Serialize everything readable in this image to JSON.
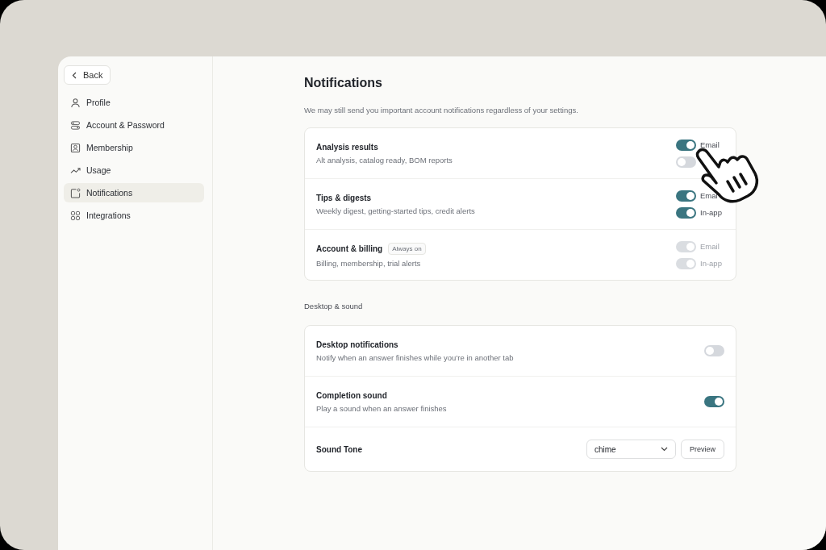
{
  "sidebar": {
    "back_button": "Back",
    "items": [
      {
        "label": "Profile",
        "selected": false
      },
      {
        "label": "Account & Password",
        "selected": false
      },
      {
        "label": "Membership",
        "selected": false
      },
      {
        "label": "Usage",
        "selected": false
      },
      {
        "label": "Notifications",
        "selected": true
      },
      {
        "label": "Integrations",
        "selected": false
      }
    ]
  },
  "page": {
    "title": "Notifications",
    "subtitle": "We may still send you important account notifications regardless of your settings."
  },
  "categories": [
    {
      "title": "Analysis results",
      "description": "Alt analysis, catalog ready, BOM reports",
      "channels": [
        {
          "label": "Email",
          "on": true,
          "disabled": false
        },
        {
          "on": false,
          "disabled": false
        }
      ]
    },
    {
      "title": "Tips & digests",
      "description": "Weekly digest, getting-started tips, credit alerts",
      "channels": [
        {
          "label": "Emai",
          "on": true,
          "disabled": false
        },
        {
          "label": "In-app",
          "on": true,
          "disabled": false
        }
      ]
    },
    {
      "title": "Account & billing",
      "badge": "Always on",
      "description": "Billing, membership, trial alerts",
      "channels": [
        {
          "label": "Email",
          "on": true,
          "disabled": true
        },
        {
          "label": "In-app",
          "on": true,
          "disabled": true
        }
      ]
    }
  ],
  "desktop_section": {
    "heading": "Desktop & sound",
    "rows": [
      {
        "kind": "toggle",
        "title": "Desktop notifications",
        "description": "Notify when an answer finishes while you’re in another tab",
        "on": false
      },
      {
        "kind": "toggle",
        "title": "Completion sound",
        "description": "Play a sound when an answer finishes",
        "on": true
      },
      {
        "kind": "select",
        "title": "Sound Tone",
        "value": "chime",
        "button": "Preview"
      }
    ]
  }
}
